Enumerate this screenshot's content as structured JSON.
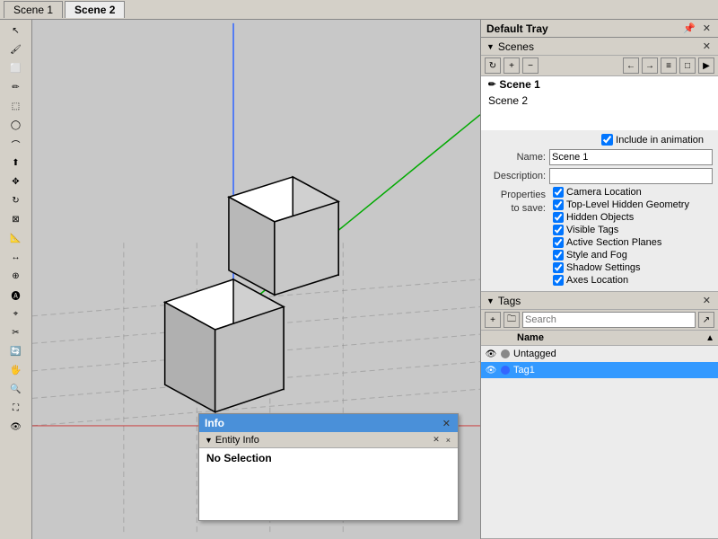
{
  "tabs": [
    {
      "label": "Scene 1",
      "active": false
    },
    {
      "label": "Scene 2",
      "active": true
    }
  ],
  "tray": {
    "title": "Default Tray",
    "pin_icon": "📌",
    "close_icon": "✕"
  },
  "scenes_panel": {
    "title": "Scenes",
    "toolbar_left": [
      "↻",
      "+",
      "−"
    ],
    "toolbar_right": [
      "←",
      "→",
      "≡",
      "□",
      "▷"
    ],
    "scene_list": [
      {
        "label": "Scene 1",
        "active": true,
        "pencil": true
      },
      {
        "label": "Scene 2",
        "active": false
      }
    ],
    "include_animation": "Include in animation",
    "name_label": "Name:",
    "name_value": "Scene 1",
    "description_label": "Description:",
    "description_value": "",
    "properties_label": "Properties\nto save:",
    "checkboxes": [
      {
        "label": "Camera Location",
        "checked": true
      },
      {
        "label": "Top-Level Hidden Geometry",
        "checked": true
      },
      {
        "label": "Hidden Objects",
        "checked": true
      },
      {
        "label": "Visible Tags",
        "checked": true
      },
      {
        "label": "Active Section Planes",
        "checked": true
      },
      {
        "label": "Style and Fog",
        "checked": true
      },
      {
        "label": "Shadow Settings",
        "checked": true
      },
      {
        "label": "Axes Location",
        "checked": true
      }
    ]
  },
  "tags_panel": {
    "title": "Tags",
    "add_icon": "+",
    "folder_icon": "🗀",
    "search_placeholder": "Search",
    "eye_icon": "👁",
    "name_header": "Name",
    "sort_icon": "▲",
    "tags": [
      {
        "label": "Untagged",
        "visible": true,
        "color": "default",
        "selected": false
      },
      {
        "label": "Tag1",
        "visible": true,
        "color": "blue",
        "selected": true
      }
    ]
  },
  "info_panel": {
    "title": "Info",
    "close_icon": "✕",
    "subheader": "Entity Info",
    "collapse_icon": "▼",
    "close2_icon": "✕",
    "content": "No Selection"
  },
  "tools": {
    "left": [
      "↖",
      "✋",
      "✏",
      "⬚",
      "◉",
      "✂",
      "⟲",
      "📐",
      "📏",
      "⊕",
      "⬡",
      "🅐",
      "⌖",
      "🔧",
      "🔍",
      "🖐",
      "👁",
      "🎥",
      "⛶"
    ]
  }
}
